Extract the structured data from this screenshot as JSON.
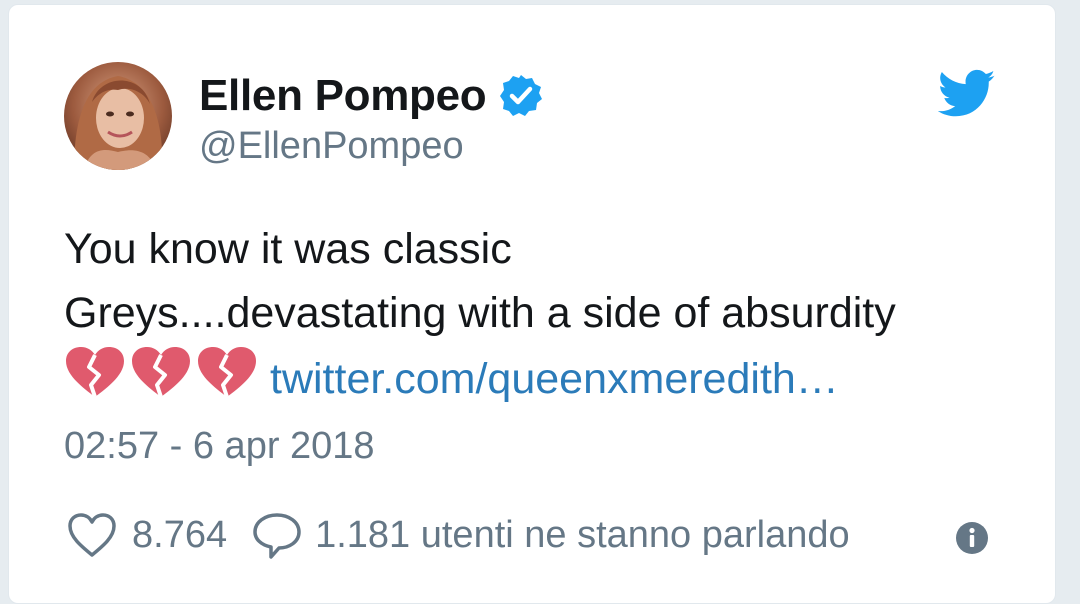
{
  "author": {
    "display_name": "Ellen Pompeo",
    "handle": "@EllenPompeo",
    "verified": true
  },
  "tweet": {
    "text_line1": "You know it was classic",
    "text_line2": "Greys....devastating with a side of absurdity",
    "emojis": [
      "broken-heart",
      "broken-heart",
      "broken-heart"
    ],
    "link_text": "twitter.com/queenxmeredith…",
    "timestamp": "02:57 - 6 apr 2018"
  },
  "stats": {
    "likes": "8.764",
    "conversation": "1.181 utenti ne stanno parlando"
  },
  "icons": {
    "brand": "twitter-bird-icon",
    "verified": "verified-badge-icon",
    "like": "heart-outline-icon",
    "reply": "speech-bubble-icon",
    "info": "info-icon"
  },
  "colors": {
    "brand_blue": "#1da1f2",
    "link_blue": "#2b7bb9",
    "text_primary": "#14171a",
    "text_secondary": "#657786",
    "broken_heart": "#e05a6d"
  }
}
